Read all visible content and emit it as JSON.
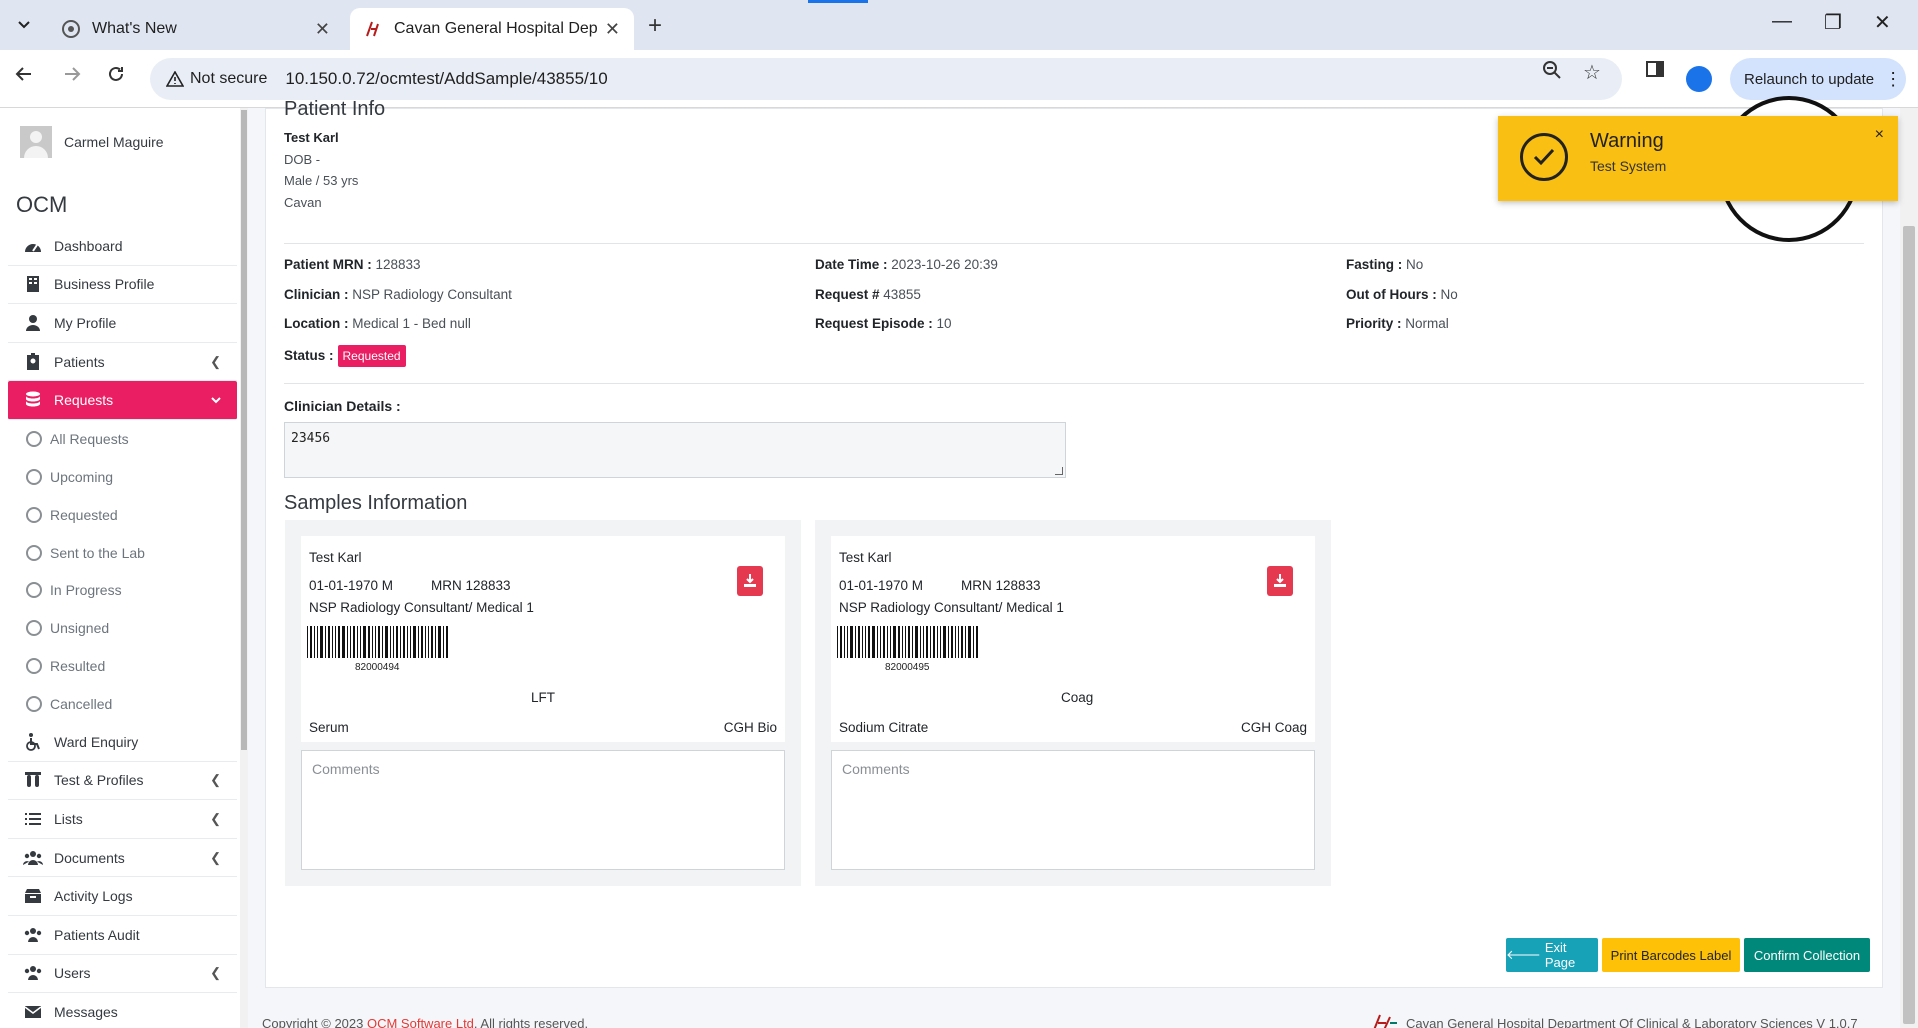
{
  "browser": {
    "tabs": [
      {
        "title": "What's New",
        "active": false
      },
      {
        "title": "Cavan General Hospital Depart",
        "active": true
      }
    ],
    "address": {
      "security": "Not secure",
      "url": "10.150.0.72/ocmtest/AddSample/43855/10"
    },
    "relaunch_label": "Relaunch to update"
  },
  "sidebar": {
    "user_name": "Carmel Maguire",
    "brand": "OCM",
    "items": [
      {
        "label": "Dashboard",
        "icon": "dashboard-icon"
      },
      {
        "label": "Business Profile",
        "icon": "building-icon"
      },
      {
        "label": "My Profile",
        "icon": "user-icon"
      },
      {
        "label": "Patients",
        "icon": "id-badge-icon"
      },
      {
        "label": "Requests",
        "icon": "database-icon"
      },
      {
        "label": "All Requests"
      },
      {
        "label": "Upcoming"
      },
      {
        "label": "Requested"
      },
      {
        "label": "Sent to the Lab"
      },
      {
        "label": "In Progress"
      },
      {
        "label": "Unsigned"
      },
      {
        "label": "Resulted"
      },
      {
        "label": "Cancelled"
      },
      {
        "label": "Ward Enquiry",
        "icon": "wheelchair-icon"
      },
      {
        "label": "Test & Profiles",
        "icon": "test-tubes-icon"
      },
      {
        "label": "Lists",
        "icon": "list-icon"
      },
      {
        "label": "Documents",
        "icon": "users-icon"
      },
      {
        "label": "Activity Logs",
        "icon": "archive-icon"
      },
      {
        "label": "Patients Audit",
        "icon": "users-icon"
      },
      {
        "label": "Users",
        "icon": "users-icon"
      },
      {
        "label": "Messages",
        "icon": "envelope-icon"
      }
    ]
  },
  "patient": {
    "section_title": "Patient Info",
    "name": "Test Karl",
    "dob": "DOB -",
    "sex_age": "Male / 53 yrs",
    "town": "Cavan"
  },
  "details": {
    "mrn_label": "Patient MRN :",
    "mrn": "128833",
    "clinician_label": "Clinician :",
    "clinician": "NSP Radiology Consultant",
    "location_label": "Location :",
    "location": "Medical 1 - Bed null",
    "status_label": "Status :",
    "status": "Requested",
    "datetime_label": "Date Time :",
    "datetime": "2023-10-26 20:39",
    "request_label": "Request #",
    "request": "43855",
    "episode_label": "Request Episode :",
    "episode": "10",
    "fasting_label": "Fasting :",
    "fasting": "No",
    "ooh_label": "Out of Hours :",
    "ooh": "No",
    "priority_label": "Priority :",
    "priority": "Normal"
  },
  "clinician_details": {
    "label": "Clinician Details :",
    "value": "23456"
  },
  "samples": {
    "title": "Samples Information",
    "cards": [
      {
        "name": "Test Karl",
        "dob_sex": "01-01-1970 M",
        "mrn": "MRN 128833",
        "clinician": "NSP Radiology Consultant/ Medical 1",
        "barcode": "82000494",
        "test": "LFT",
        "container": "Serum",
        "dept": "CGH Bio",
        "comments_placeholder": "Comments"
      },
      {
        "name": "Test Karl",
        "dob_sex": "01-01-1970 M",
        "mrn": "MRN 128833",
        "clinician": "NSP Radiology Consultant/ Medical 1",
        "barcode": "82000495",
        "test": "Coag",
        "container": "Sodium Citrate",
        "dept": "CGH Coag",
        "comments_placeholder": "Comments"
      }
    ]
  },
  "actions": {
    "exit": "Exit Page",
    "print": "Print Barcodes Label",
    "confirm": "Confirm Collection"
  },
  "footer": {
    "copyright": "Copyright © 2023 ",
    "company": "OCM Software Ltd",
    "rights": ". All rights reserved.",
    "right_text": "Cavan General Hospital Department Of Clinical & Laboratory Sciences V 1.0.7"
  },
  "toast": {
    "title": "Warning",
    "message": "Test System"
  },
  "colors": {
    "accent": "#e91e63",
    "warning": "#f9bf12",
    "exit": "#17a2b8",
    "confirm": "#00897b"
  }
}
